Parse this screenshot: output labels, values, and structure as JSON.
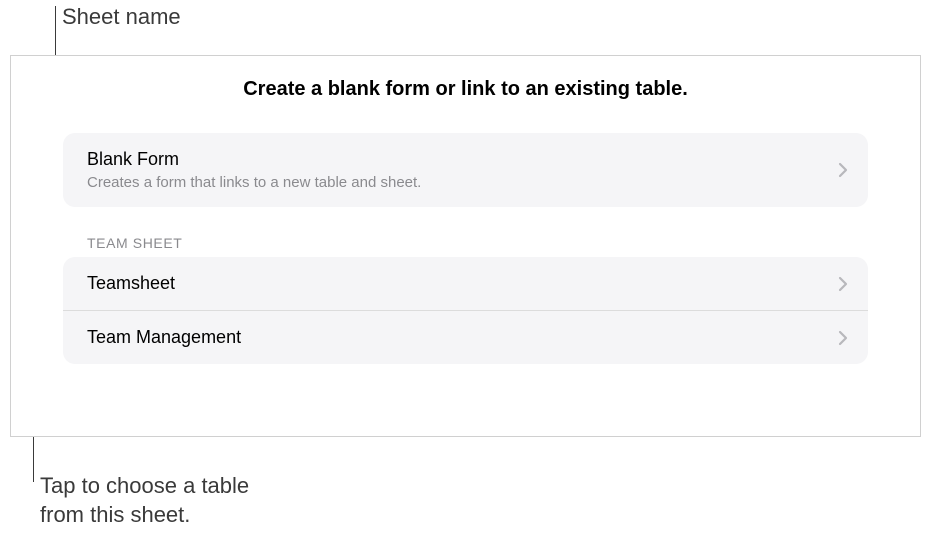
{
  "callouts": {
    "top": "Sheet name",
    "bottom_line1": "Tap to choose a table",
    "bottom_line2": "from this sheet."
  },
  "panel": {
    "title": "Create a blank form or link to an existing table.",
    "blank_form": {
      "title": "Blank Form",
      "subtitle": "Creates a form that links to a new table and sheet."
    },
    "section_header": "TEAM SHEET",
    "tables": [
      {
        "name": "Teamsheet"
      },
      {
        "name": "Team Management"
      }
    ]
  }
}
